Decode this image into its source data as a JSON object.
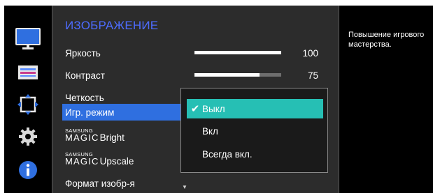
{
  "sidebar": {
    "icons": [
      {
        "name": "monitor-icon",
        "color": "#2f6fe0"
      },
      {
        "name": "onscreen-display-icon",
        "color": "#5a8cff"
      },
      {
        "name": "position-move-icon",
        "color": "#2f6fe0"
      },
      {
        "name": "settings-gear-icon",
        "color": "#d8d8d8"
      },
      {
        "name": "info-icon",
        "color": "#2f6fe0"
      }
    ]
  },
  "menu": {
    "title": "ИЗОБРАЖЕНИЕ",
    "items": [
      {
        "label": "Яркость",
        "value": "100",
        "level": 100
      },
      {
        "label": "Контраст",
        "value": "75",
        "level": 75
      },
      {
        "label": "Четкость"
      },
      {
        "label": "Игр. режим"
      },
      {
        "brand_top": "SAMSUNG",
        "brand_bottom": "MAGIC",
        "label": "Bright"
      },
      {
        "brand_top": "SAMSUNG",
        "brand_bottom": "MAGIC",
        "label": "Upscale"
      },
      {
        "label": "Формат изобр-я"
      }
    ],
    "scroll_indicator": "▼"
  },
  "submenu": {
    "options": [
      {
        "label": "Выкл",
        "checked": true
      },
      {
        "label": "Вкл",
        "checked": false
      },
      {
        "label": "Всегда вкл.",
        "checked": false
      }
    ],
    "check_glyph": "✔"
  },
  "description": {
    "line1": "Повышение игрового",
    "line2": "мастерства."
  },
  "colors": {
    "title": "#4d6cff",
    "selected_item": "#2f6fe0",
    "active_option": "#26bfb4",
    "panel": "#2c2c2c"
  }
}
